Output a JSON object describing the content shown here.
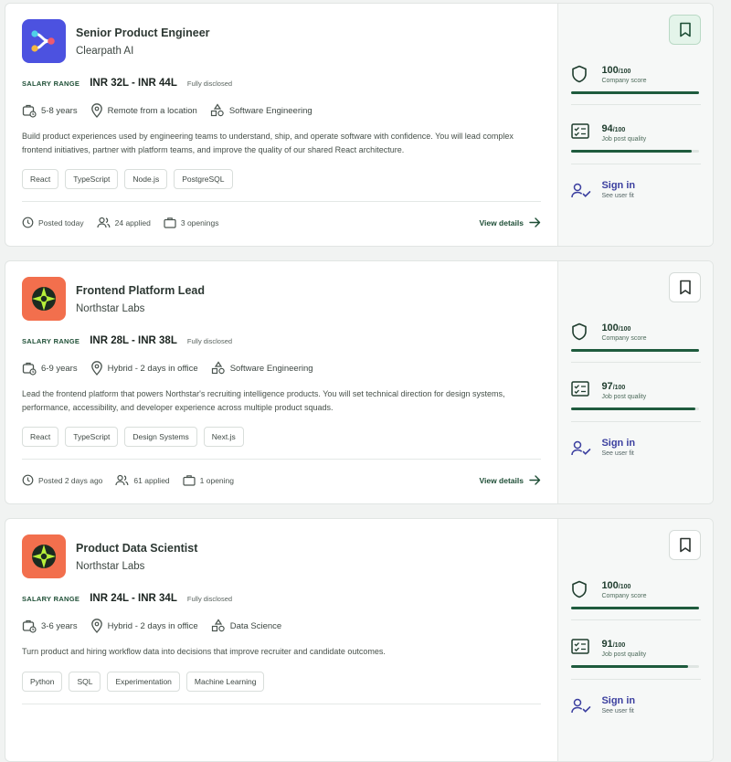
{
  "jobs": [
    {
      "title": "Senior Product Engineer",
      "company": "Clearpath AI",
      "salary_label": "SALARY RANGE",
      "salary": "INR 32L - INR 44L",
      "salary_note": "Fully disclosed",
      "experience": "5-8 years",
      "location": "Remote from a location",
      "category": "Software Engineering",
      "description": "Build product experiences used by engineering teams to understand, ship, and operate software with confidence. You will lead complex frontend initiatives, partner with platform teams, and improve the quality of our shared React architecture.",
      "tags": [
        "React",
        "TypeScript",
        "Node.js",
        "PostgreSQL"
      ],
      "posted": "Posted today",
      "applied": "24 applied",
      "openings": "3 openings",
      "view_label": "View details",
      "company_score": "100",
      "company_score_den": "/100",
      "company_score_label": "Company score",
      "company_score_pct": 100,
      "post_quality": "94",
      "post_quality_den": "/100",
      "post_quality_label": "Job post quality",
      "post_quality_pct": 94,
      "signin_title": "Sign in",
      "signin_sub": "See user fit",
      "bookmarked": true
    },
    {
      "title": "Frontend Platform Lead",
      "company": "Northstar Labs",
      "salary_label": "SALARY RANGE",
      "salary": "INR 28L - INR 38L",
      "salary_note": "Fully disclosed",
      "experience": "6-9 years",
      "location": "Hybrid - 2 days in office",
      "category": "Software Engineering",
      "description": "Lead the frontend platform that powers Northstar's recruiting intelligence products. You will set technical direction for design systems, performance, accessibility, and developer experience across multiple product squads.",
      "tags": [
        "React",
        "TypeScript",
        "Design Systems",
        "Next.js"
      ],
      "posted": "Posted 2 days ago",
      "applied": "61 applied",
      "openings": "1 opening",
      "view_label": "View details",
      "company_score": "100",
      "company_score_den": "/100",
      "company_score_label": "Company score",
      "company_score_pct": 100,
      "post_quality": "97",
      "post_quality_den": "/100",
      "post_quality_label": "Job post quality",
      "post_quality_pct": 97,
      "signin_title": "Sign in",
      "signin_sub": "See user fit",
      "bookmarked": false
    },
    {
      "title": "Product Data Scientist",
      "company": "Northstar Labs",
      "salary_label": "SALARY RANGE",
      "salary": "INR 24L - INR 34L",
      "salary_note": "Fully disclosed",
      "experience": "3-6 years",
      "location": "Hybrid - 2 days in office",
      "category": "Data Science",
      "description": "Turn product and hiring workflow data into decisions that improve recruiter and candidate outcomes.",
      "tags": [
        "Python",
        "SQL",
        "Experimentation",
        "Machine Learning"
      ],
      "posted": "",
      "applied": "",
      "openings": "",
      "view_label": "",
      "company_score": "100",
      "company_score_den": "/100",
      "company_score_label": "Company score",
      "company_score_pct": 100,
      "post_quality": "91",
      "post_quality_den": "/100",
      "post_quality_label": "Job post quality",
      "post_quality_pct": 91,
      "signin_title": "Sign in",
      "signin_sub": "See user fit",
      "bookmarked": false
    }
  ],
  "colors": {
    "accent_green": "#1e5b3d",
    "signin_blue": "#3b3f9f",
    "logo_blue": "#4c52e0",
    "logo_orange": "#f26f4d"
  }
}
